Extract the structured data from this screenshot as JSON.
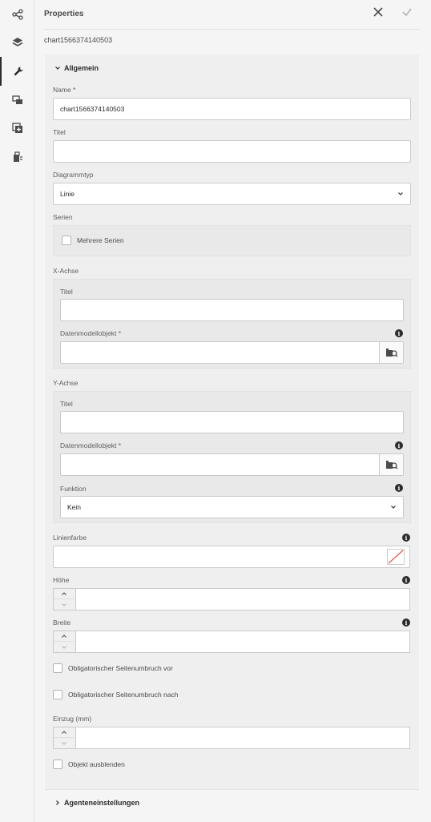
{
  "rail": {
    "items": [
      {
        "icon": "share-icon"
      },
      {
        "icon": "layers-icon"
      },
      {
        "icon": "wrench-icon",
        "active": true
      },
      {
        "icon": "data-source-icon"
      },
      {
        "icon": "add-fragment-icon"
      },
      {
        "icon": "report-icon"
      }
    ]
  },
  "header": {
    "title": "Properties",
    "close_icon": "close-icon",
    "done_icon": "check-icon"
  },
  "subtitle": "chart1566374140503",
  "section_general": {
    "title": "Allgemein",
    "name": {
      "label": "Name *",
      "value": "chart1566374140503"
    },
    "titel": {
      "label": "Titel",
      "value": ""
    },
    "diagrammtyp": {
      "label": "Diagrammtyp",
      "value": "Linie"
    },
    "serien": {
      "label": "Serien",
      "checkbox_label": "Mehrere Serien"
    },
    "x_achse": {
      "label": "X-Achse",
      "titel_label": "Titel",
      "titel_value": "",
      "datenmodell_label": "Datenmodellobjekt *",
      "datenmodell_value": ""
    },
    "y_achse": {
      "label": "Y-Achse",
      "titel_label": "Titel",
      "titel_value": "",
      "datenmodell_label": "Datenmodellobjekt *",
      "datenmodell_value": "",
      "funktion_label": "Funktion",
      "funktion_value": "Kein"
    },
    "linienfarbe": {
      "label": "Linienfarbe",
      "value": ""
    },
    "hoehe": {
      "label": "Höhe",
      "value": ""
    },
    "breite": {
      "label": "Breite",
      "value": ""
    },
    "pagebreak_before": "Obligatorischer Seitenumbruch vor",
    "pagebreak_after": "Obligatorischer Seitenumbruch nach",
    "einzug": {
      "label": "Einzug (mm)",
      "value": ""
    },
    "hide_object": "Objekt ausblenden"
  },
  "section_agent": {
    "title": "Agenteneinstellungen"
  }
}
